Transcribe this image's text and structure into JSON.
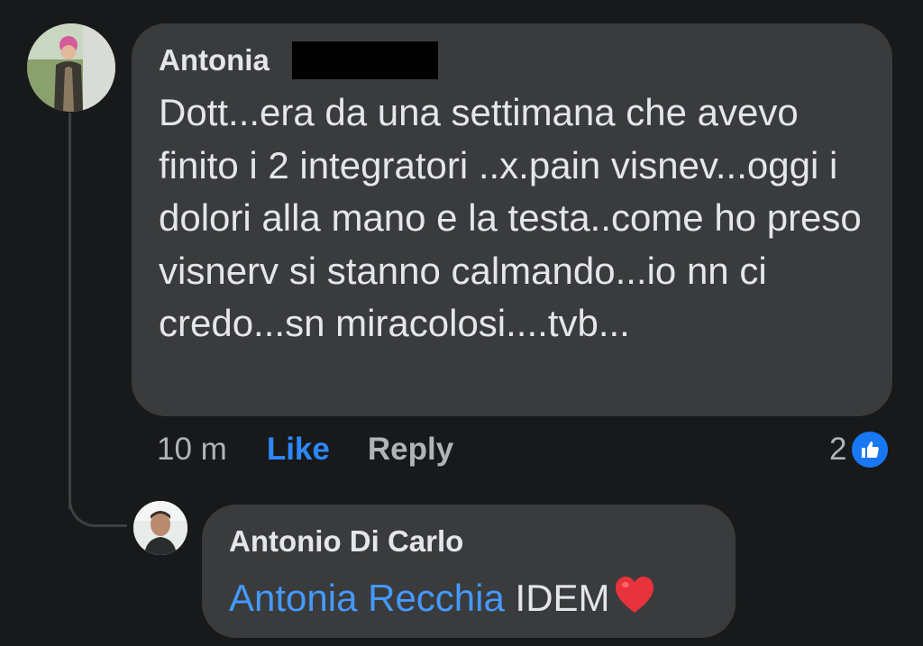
{
  "comment": {
    "author": "Antonia",
    "text": "Dott...era da una settimana che avevo finito i 2 integratori ..x.pain visnev...oggi i dolori alla mano e la testa..come ho preso visnerv si stanno calmando...io nn ci credo...sn miracolosi....tvb...",
    "time": "10 m",
    "like_label": "Like",
    "reply_label": "Reply",
    "reaction_count": "2"
  },
  "reply": {
    "author": "Antonio Di Carlo",
    "mention": "Antonia Recchia",
    "text": "IDEM"
  },
  "colors": {
    "background": "#18191a",
    "bubble": "#3a3b3c",
    "accent": "#2d88ff",
    "mention": "#4599ff"
  },
  "icons": {
    "reaction": "like-reaction-icon",
    "emoji": "red-heart-icon"
  }
}
